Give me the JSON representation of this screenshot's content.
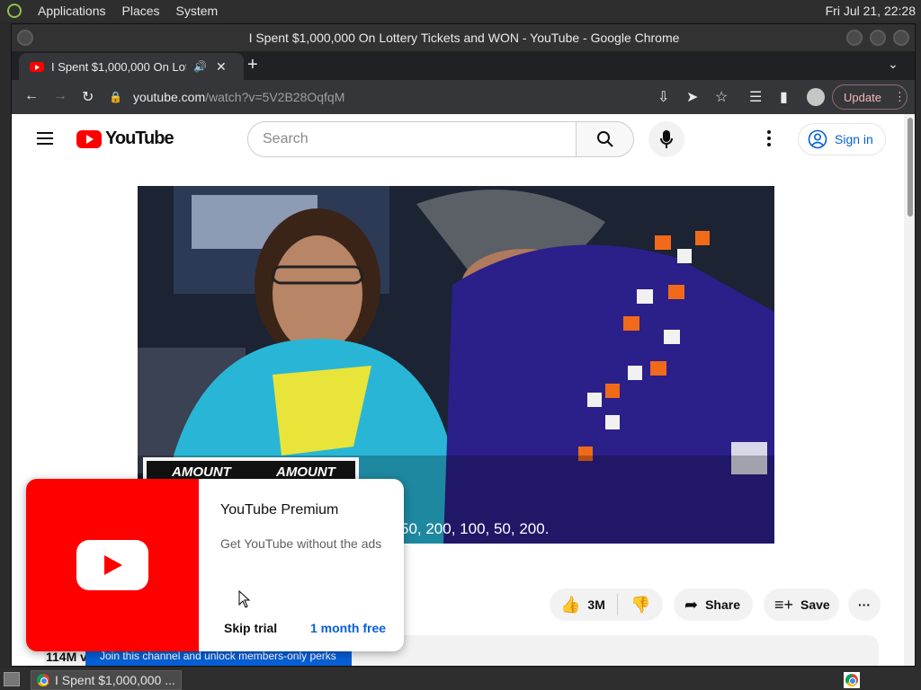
{
  "panel": {
    "menu": [
      "Applications",
      "Places",
      "System"
    ],
    "clock": "Fri Jul 21, 22:28"
  },
  "window": {
    "title": "I Spent $1,000,000 On Lottery Tickets and WON - YouTube - Google Chrome"
  },
  "tab": {
    "label": "I Spent $1,000,000 On Lot"
  },
  "toolbar": {
    "url_host": "youtube.com",
    "url_path": "/watch?v=5V2B28OqfqM",
    "update_label": "Update"
  },
  "youtube": {
    "logo_text": "YouTube",
    "search_placeholder": "Search",
    "signin_label": "Sign in"
  },
  "video": {
    "caption": "50, 200, 100, 50, 200.",
    "sign_texts": [
      "AMOUNT",
      "AMOUNT"
    ]
  },
  "actions": {
    "likes": "3M",
    "share": "Share",
    "save": "Save"
  },
  "description": {
    "views": "114M v",
    "join_banner": "Join this channel and unlock members-only perks"
  },
  "premium_popup": {
    "title": "YouTube Premium",
    "subtitle": "Get YouTube without the ads",
    "skip": "Skip trial",
    "cta": "1 month free"
  },
  "taskbar": {
    "item_label": "I Spent $1,000,000 ..."
  },
  "colors": {
    "youtube_red": "#ff0000",
    "link_blue": "#065fd4",
    "chrome_dark": "#35363a"
  }
}
